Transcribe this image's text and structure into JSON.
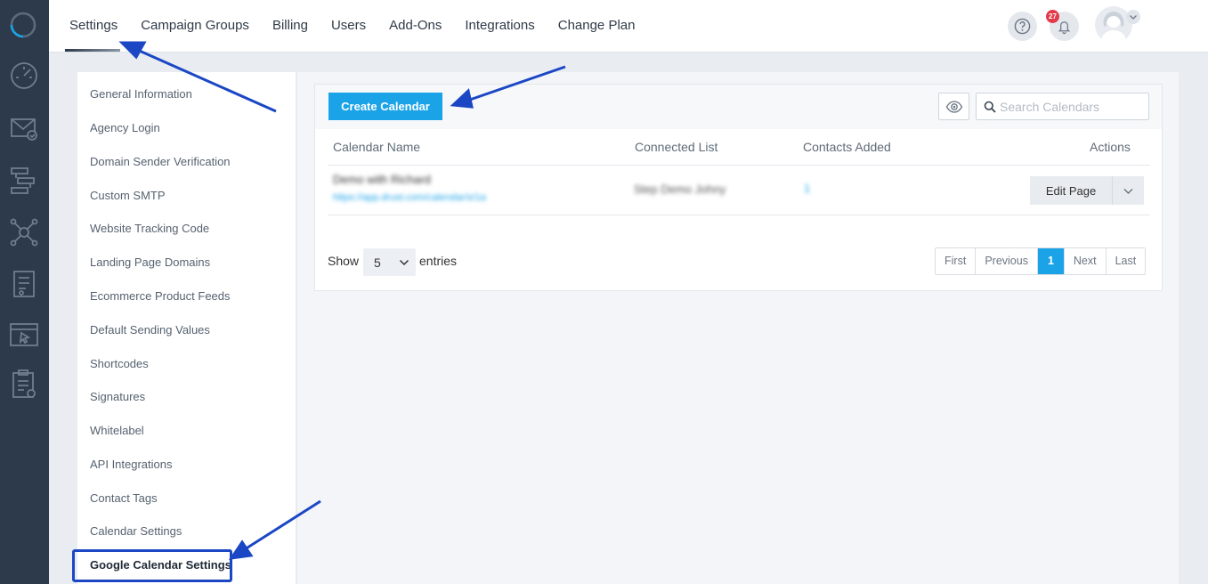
{
  "nav": {
    "tabs": [
      {
        "label": "Settings",
        "active": true
      },
      {
        "label": "Campaign Groups"
      },
      {
        "label": "Billing"
      },
      {
        "label": "Users"
      },
      {
        "label": "Add-Ons"
      },
      {
        "label": "Integrations"
      },
      {
        "label": "Change Plan"
      }
    ],
    "notification_count": "27"
  },
  "rail": {
    "icons": [
      "logo-ring-icon",
      "dashboard-gauge-icon",
      "email-check-icon",
      "automation-flow-icon",
      "network-hub-icon",
      "form-document-icon",
      "landing-page-cursor-icon",
      "clipboard-list-icon"
    ]
  },
  "sidebar": {
    "items": [
      "General Information",
      "Agency Login",
      "Domain Sender Verification",
      "Custom SMTP",
      "Website Tracking Code",
      "Landing Page Domains",
      "Ecommerce Product Feeds",
      "Default Sending Values",
      "Shortcodes",
      "Signatures",
      "Whitelabel",
      "API Integrations",
      "Contact Tags",
      "Calendar Settings",
      "Google Calendar Settings"
    ],
    "active_item": "Google Calendar Settings"
  },
  "toolbar": {
    "create_label": "Create Calendar",
    "search_placeholder": "Search Calendars"
  },
  "table": {
    "headers": [
      "Calendar Name",
      "Connected List",
      "Contacts Added",
      "Actions"
    ],
    "rows": [
      {
        "name": "Demo with Richard",
        "url": "https://app.drust.com/calendar/s/1a",
        "list": "Step Demo Johny",
        "contacts": "1",
        "action_label": "Edit Page"
      }
    ]
  },
  "footer": {
    "show_label": "Show",
    "entries_value": "5",
    "entries_label": "entries",
    "pager": {
      "first": "First",
      "previous": "Previous",
      "current": "1",
      "next": "Next",
      "last": "Last"
    }
  },
  "colors": {
    "accent": "#1ba3e8",
    "rail": "#2d3a4b",
    "annotation": "#1b47c5",
    "badge": "#e23b4a"
  }
}
